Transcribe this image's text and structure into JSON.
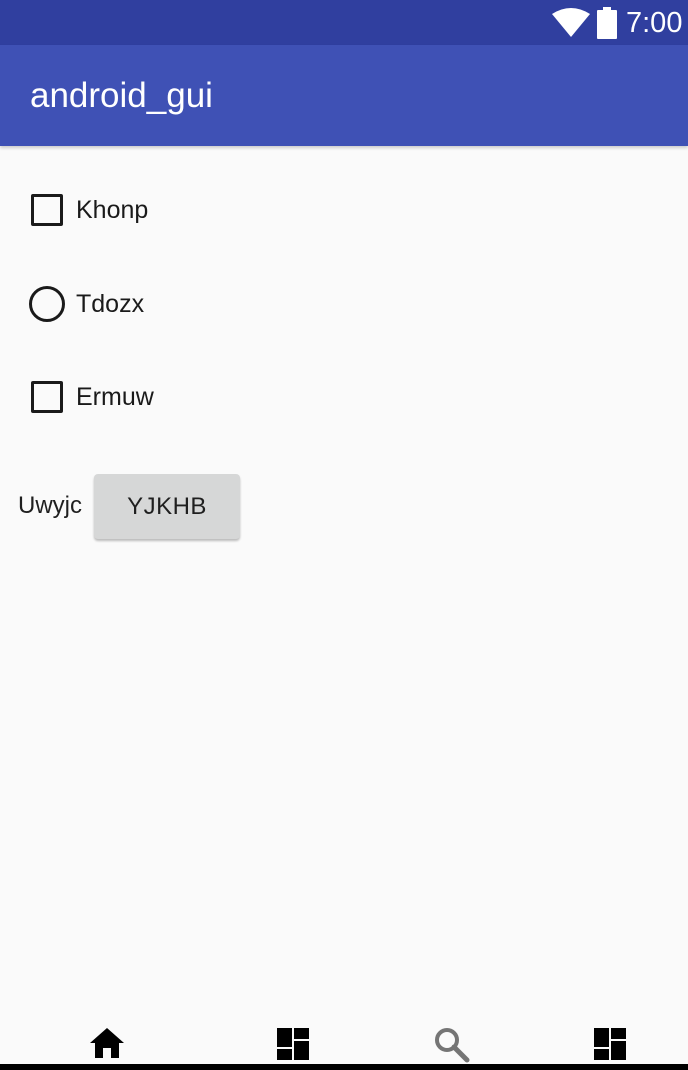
{
  "status_bar": {
    "time": "7:00",
    "icons": [
      "wifi-icon",
      "battery-icon"
    ],
    "color": "#303f9f"
  },
  "app_bar": {
    "title": "android_gui",
    "color": "#3f51b5"
  },
  "options": [
    {
      "type": "checkbox",
      "label": "Khonp",
      "checked": false
    },
    {
      "type": "radio",
      "label": "Tdozx",
      "checked": false
    },
    {
      "type": "checkbox",
      "label": "Ermuw",
      "checked": false
    }
  ],
  "row": {
    "label": "Uwyjc",
    "button_label": "YJKHB"
  },
  "bottom_nav": {
    "items": [
      {
        "icon": "home-icon",
        "active": true
      },
      {
        "icon": "dashboard-icon",
        "active": false
      },
      {
        "icon": "search-icon",
        "active": false
      },
      {
        "icon": "dashboard-icon",
        "active": false
      }
    ]
  }
}
